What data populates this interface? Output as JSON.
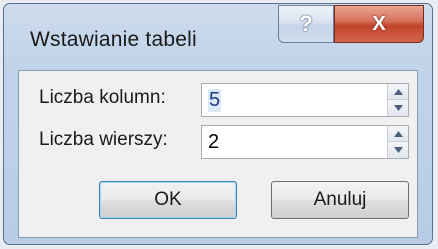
{
  "dialog": {
    "title": "Wstawianie tabeli",
    "help_glyph": "?",
    "close_glyph": "X"
  },
  "fields": [
    {
      "label": "Liczba kolumn:",
      "value": "5",
      "selected": true
    },
    {
      "label": "Liczba wierszy:",
      "value": "2",
      "selected": false
    }
  ],
  "buttons": {
    "ok_label": "OK",
    "cancel_label": "Anuluj"
  },
  "colors": {
    "accent": "#3c7fb1",
    "close_button": "#c4432b",
    "titlebar": "#c2d4ea"
  },
  "icons": [
    "help-icon",
    "close-icon",
    "spin-up-icon",
    "spin-down-icon"
  ]
}
